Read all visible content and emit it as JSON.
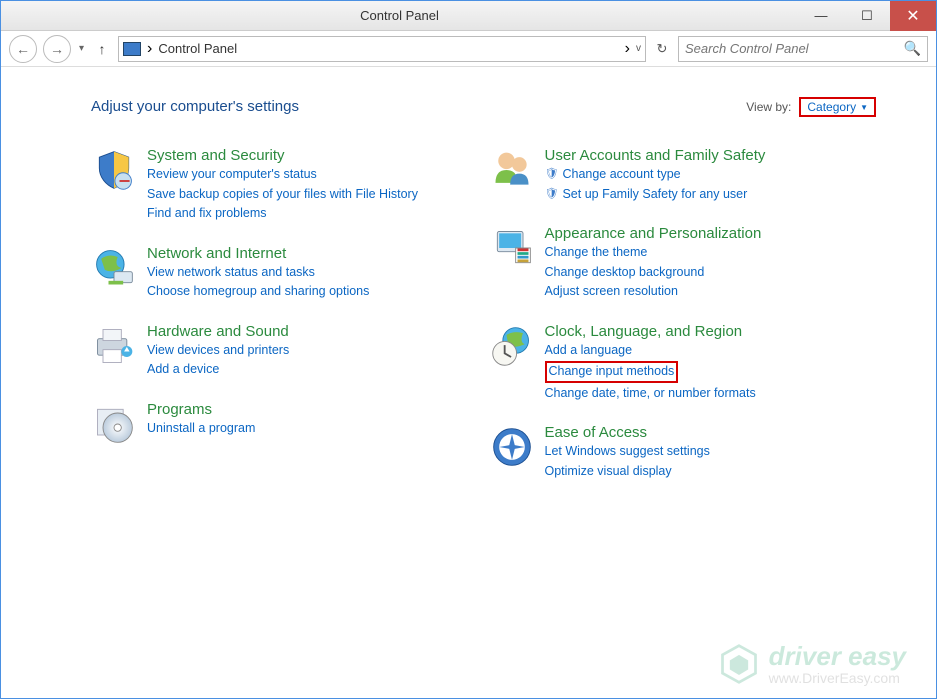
{
  "window": {
    "title": "Control Panel"
  },
  "breadcrumb": {
    "location": "Control Panel",
    "separator": "›"
  },
  "search": {
    "placeholder": "Search Control Panel"
  },
  "header": {
    "title": "Adjust your computer's settings",
    "viewby_label": "View by:",
    "viewby_value": "Category"
  },
  "left": [
    {
      "title": "System and Security",
      "links": [
        "Review your computer's status",
        "Save backup copies of your files with File History",
        "Find and fix problems"
      ]
    },
    {
      "title": "Network and Internet",
      "links": [
        "View network status and tasks",
        "Choose homegroup and sharing options"
      ]
    },
    {
      "title": "Hardware and Sound",
      "links": [
        "View devices and printers",
        "Add a device"
      ]
    },
    {
      "title": "Programs",
      "links": [
        "Uninstall a program"
      ]
    }
  ],
  "right": [
    {
      "title": "User Accounts and Family Safety",
      "links": [
        "Change account type",
        "Set up Family Safety for any user"
      ],
      "shield": true
    },
    {
      "title": "Appearance and Personalization",
      "links": [
        "Change the theme",
        "Change desktop background",
        "Adjust screen resolution"
      ]
    },
    {
      "title": "Clock, Language, and Region",
      "links": [
        "Add a language",
        "Change input methods",
        "Change date, time, or number formats"
      ],
      "highlight_index": 1
    },
    {
      "title": "Ease of Access",
      "links": [
        "Let Windows suggest settings",
        "Optimize visual display"
      ]
    }
  ],
  "watermark": {
    "brand": "driver easy",
    "url": "www.DriverEasy.com"
  }
}
